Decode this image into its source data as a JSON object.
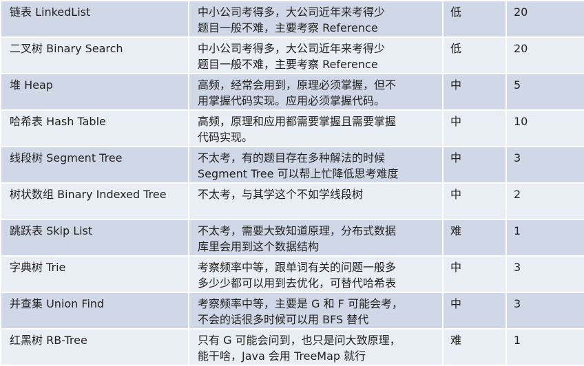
{
  "rows": [
    {
      "name": "链表 LinkedList",
      "desc_lines": [
        "中小公司考得多，大公司近年来考得少",
        "题目一般不难，主要考察 Reference"
      ],
      "difficulty": "低",
      "frequency": "20"
    },
    {
      "name": "二叉树 Binary Search",
      "desc_lines": [
        "中小公司考得多，大公司近年来考得少",
        "题目一般不难，主要考察 Reference"
      ],
      "difficulty": "低",
      "frequency": "20"
    },
    {
      "name": "堆 Heap",
      "desc_lines": [
        "高频，经常会用到，原理必须掌握，但不",
        "用掌握代码实现。应用必须掌握代码。"
      ],
      "difficulty": "中",
      "frequency": "5"
    },
    {
      "name": "哈希表 Hash Table",
      "desc_lines": [
        "高频，原理和应用都需要掌握且需要掌握",
        "代码实现。"
      ],
      "difficulty": "中",
      "frequency": "10"
    },
    {
      "name": "线段树 Segment Tree",
      "desc_lines": [
        "不太考，有的题目存在多种解法的时候",
        "Segment Tree 可以帮上忙降低思考难度"
      ],
      "difficulty": "中",
      "frequency": "3"
    },
    {
      "name": "树状数组 Binary Indexed Tree",
      "desc_lines": [
        "不太考，与其学这个不如学线段树"
      ],
      "difficulty": "中",
      "frequency": "2"
    },
    {
      "name": "跳跃表 Skip List",
      "desc_lines": [
        "不太考，需要大致知道原理，分布式数据",
        "库里会用到这个数据结构"
      ],
      "difficulty": "难",
      "frequency": "1"
    },
    {
      "name": "字典树 Trie",
      "desc_lines": [
        "考察频率中等，跟单词有关的问题一般多",
        "多少少都可以用到去优化，可替代哈希表"
      ],
      "difficulty": "中",
      "frequency": "3"
    },
    {
      "name": "并查集 Union Find",
      "desc_lines": [
        "考察频率中等，主要是 G 和 F 可能会考，",
        "不会的话很多时候可以用 BFS 替代"
      ],
      "difficulty": "中",
      "frequency": "3"
    },
    {
      "name": "红黑树 RB-Tree",
      "desc_lines": [
        "只有 G 可能会问到，也只是问大致原理，",
        "能干啥，Java 会用 TreeMap 就行"
      ],
      "difficulty": "难",
      "frequency": "1"
    }
  ]
}
